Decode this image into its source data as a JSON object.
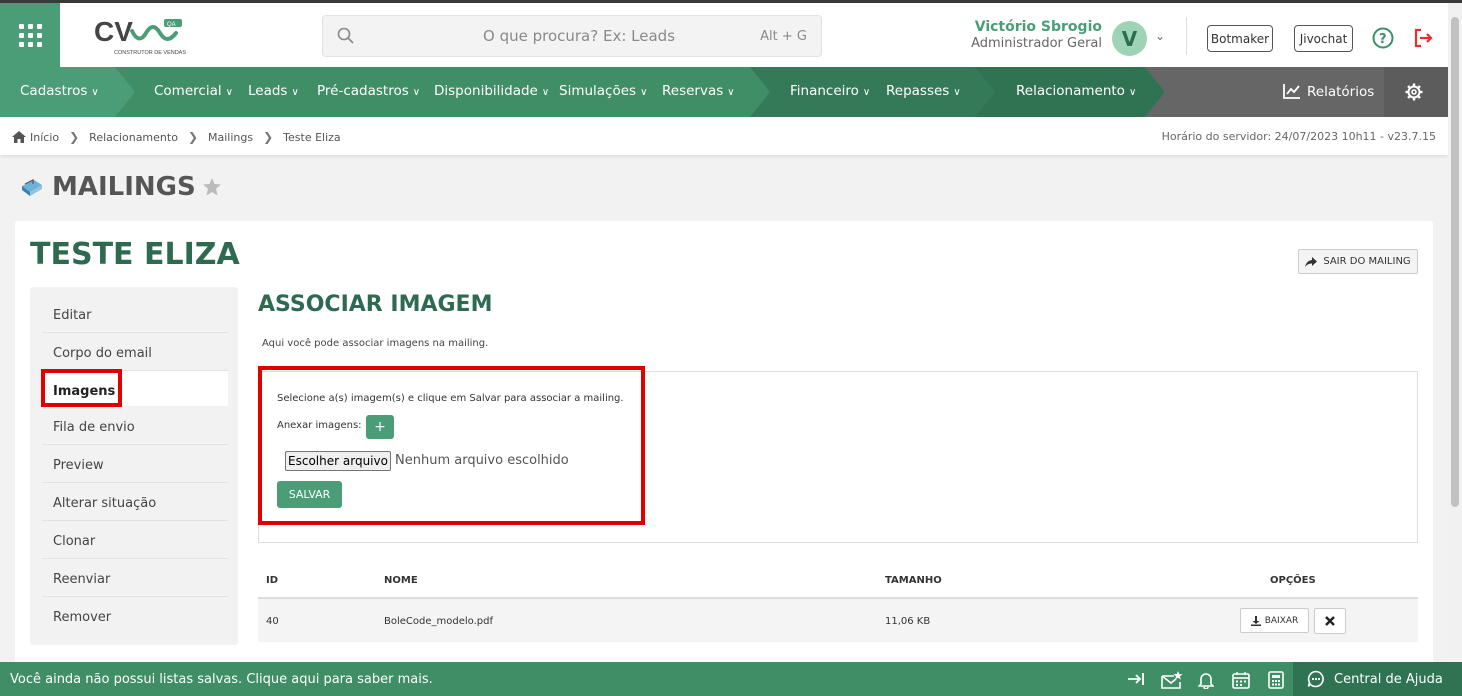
{
  "header": {
    "search_placeholder": "O que procura? Ex: Leads",
    "search_shortcut": "Alt + G",
    "user_name": "Victório Sbrogio",
    "user_role": "Administrador Geral",
    "avatar_letter": "V",
    "botmaker_label": "Botmaker",
    "jivochat_label": "Jivochat",
    "logo_sub": "CONSTRUTOR DE VENDAS",
    "logo_badge": "QA"
  },
  "nav": {
    "items": [
      "Cadastros",
      "Comercial",
      "Leads",
      "Pré-cadastros",
      "Disponibilidade",
      "Simulações",
      "Reservas",
      "Financeiro",
      "Repasses",
      "Relacionamento"
    ],
    "reports_label": "Relatórios"
  },
  "breadcrumb": {
    "items": [
      "Início",
      "Relacionamento",
      "Mailings",
      "Teste Eliza"
    ],
    "server_time": "Horário do servidor: 24/07/2023 10h11 - v23.7.15"
  },
  "page": {
    "title": "MAILINGS",
    "heading": "TESTE ELIZA",
    "exit_label": "SAIR DO MAILING"
  },
  "sidebar": {
    "items": [
      "Editar",
      "Corpo do email",
      "Imagens",
      "Fila de envio",
      "Preview",
      "Alterar situação",
      "Clonar",
      "Reenviar",
      "Remover"
    ],
    "active": "Imagens"
  },
  "form": {
    "title": "ASSOCIAR IMAGEM",
    "description": "Aqui você pode associar imagens na mailing.",
    "instruction": "Selecione a(s) imagem(s) e clique em Salvar para associar a mailing.",
    "attach_label": "Anexar imagens:",
    "plus_label": "+",
    "file_button": "Escolher arquivo",
    "no_file": "Nenhum arquivo escolhido",
    "save_label": "SALVAR"
  },
  "table": {
    "headers": [
      "ID",
      "NOME",
      "TAMANHO",
      "OPÇÕES"
    ],
    "rows": [
      {
        "id": "40",
        "name": "BoleCode_modelo.pdf",
        "size": "11,06 KB",
        "download": "BAIXAR"
      }
    ]
  },
  "footer": {
    "message": "Você ainda não possui listas salvas. Clique aqui para saber mais.",
    "help_label": "Central de Ajuda"
  },
  "colors": {
    "primary": "#4a9d77",
    "nav": "#3f8e66",
    "heading": "#2d6a50",
    "highlight": "#e00000"
  }
}
